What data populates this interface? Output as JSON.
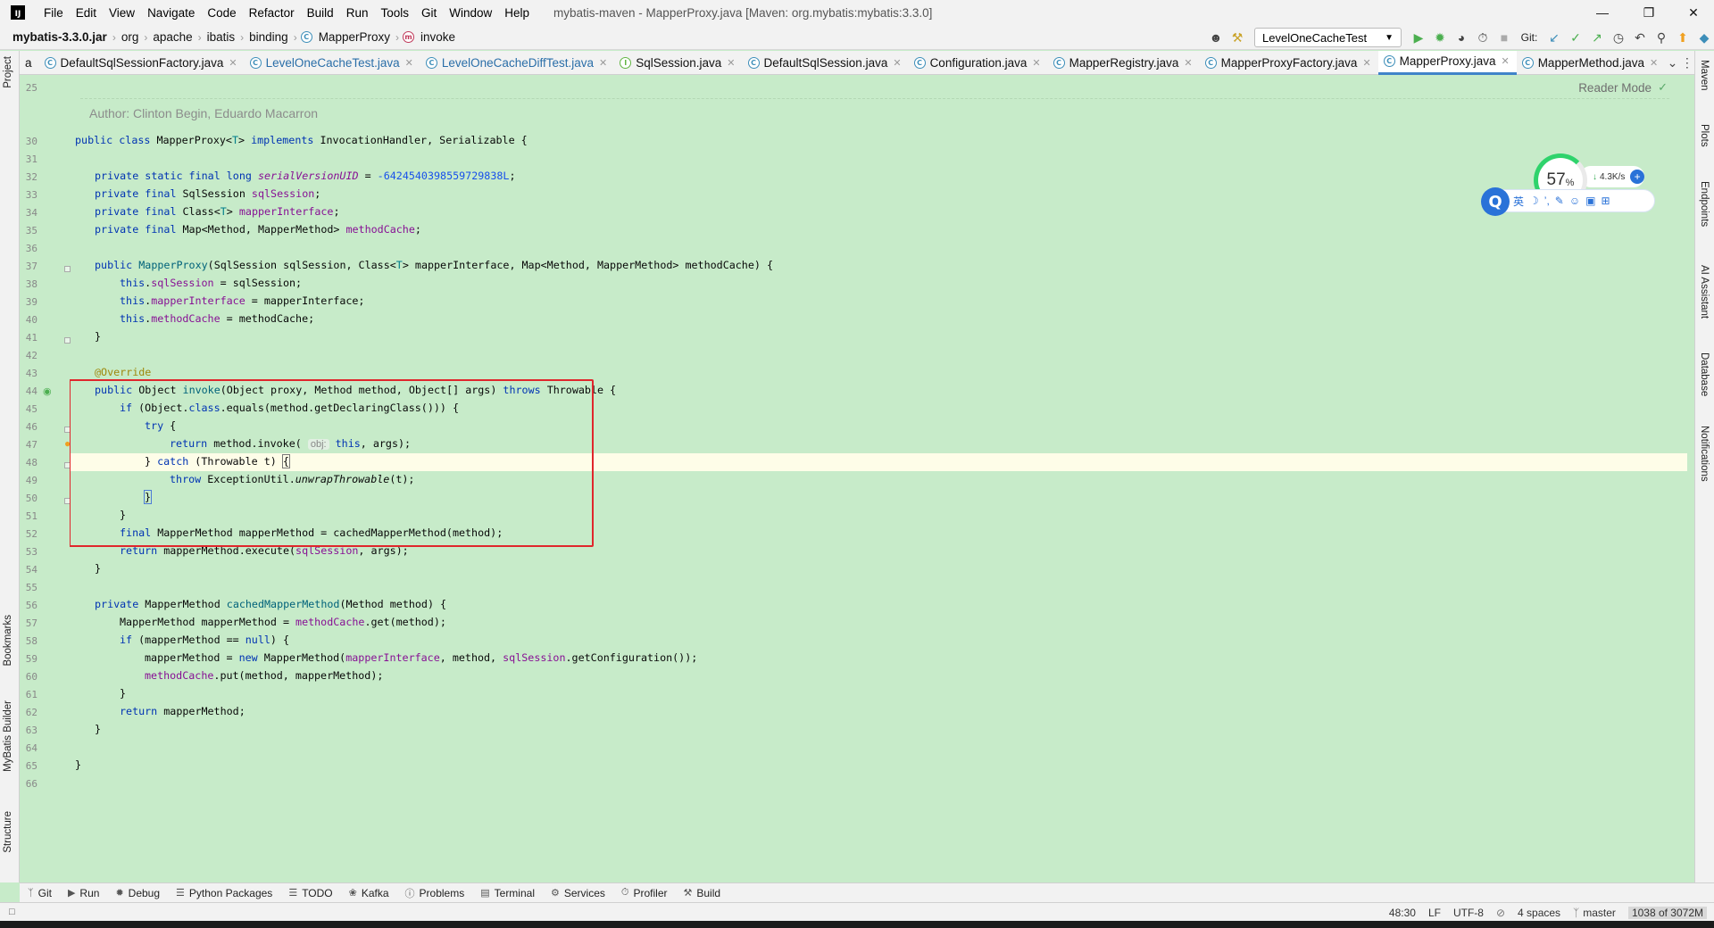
{
  "menubar": {
    "app_logo": "IJ",
    "items": [
      "File",
      "Edit",
      "View",
      "Navigate",
      "Code",
      "Refactor",
      "Build",
      "Run",
      "Tools",
      "Git",
      "Window",
      "Help"
    ],
    "window_title": "mybatis-maven - MapperProxy.java [Maven: org.mybatis:mybatis:3.3.0]",
    "window_controls": [
      "minimize-icon",
      "restore-icon",
      "close-icon"
    ]
  },
  "navbar": {
    "crumbs": [
      "mybatis-3.3.0.jar",
      "org",
      "apache",
      "ibatis",
      "binding",
      "MapperProxy",
      "invoke"
    ],
    "run_config": "LevelOneCacheTest",
    "git_label": "Git:"
  },
  "tabs": [
    {
      "label": "a",
      "kind": "partial"
    },
    {
      "label": "DefaultSqlSessionFactory.java",
      "kind": "class"
    },
    {
      "label": "LevelOneCacheTest.java",
      "kind": "test"
    },
    {
      "label": "LevelOneCacheDiffTest.java",
      "kind": "test"
    },
    {
      "label": "SqlSession.java",
      "kind": "interface"
    },
    {
      "label": "DefaultSqlSession.java",
      "kind": "class"
    },
    {
      "label": "Configuration.java",
      "kind": "class"
    },
    {
      "label": "MapperRegistry.java",
      "kind": "class"
    },
    {
      "label": "MapperProxyFactory.java",
      "kind": "class"
    },
    {
      "label": "MapperProxy.java",
      "kind": "class",
      "active": true
    },
    {
      "label": "MapperMethod.java",
      "kind": "class"
    }
  ],
  "left_tools": [
    "Project",
    "Bookmarks",
    "MyBatis Builder",
    "Structure"
  ],
  "right_tools": [
    "Maven",
    "Plots",
    "Endpoints",
    "AI Assistant",
    "Database",
    "Notifications"
  ],
  "editor": {
    "reader_mode": "Reader Mode",
    "author": "Author: Clinton Begin, Eduardo Macarron",
    "line_numbers": [
      "25",
      "30",
      "31",
      "32",
      "33",
      "34",
      "35",
      "36",
      "37",
      "38",
      "39",
      "40",
      "41",
      "42",
      "43",
      "44",
      "45",
      "46",
      "47",
      "48",
      "49",
      "50",
      "51",
      "52",
      "53",
      "54",
      "55",
      "56",
      "57",
      "58",
      "59",
      "60",
      "61",
      "62",
      "63",
      "64",
      "65",
      "66"
    ],
    "code": {
      "l30_a": "public class ",
      "l30_b": "MapperProxy<",
      "l30_c": "T",
      "l30_d": "> ",
      "l30_e": "implements",
      "l30_f": " InvocationHandler, Serializable {",
      "l32_a": "private static final long ",
      "l32_b": "serialVersionUID",
      "l32_c": " = ",
      "l32_d": "-6424540398559729838L",
      "l32_e": ";",
      "l33_a": "private final ",
      "l33_b": "SqlSession ",
      "l33_c": "sqlSession",
      "l33_d": ";",
      "l34_a": "private final ",
      "l34_b": "Class<",
      "l34_c": "T",
      "l34_d": "> ",
      "l34_e": "mapperInterface",
      "l34_f": ";",
      "l35_a": "private final ",
      "l35_b": "Map<Method, MapperMethod> ",
      "l35_c": "methodCache",
      "l35_d": ";",
      "l37_a": "public ",
      "l37_b": "MapperProxy",
      "l37_c": "(SqlSession sqlSession, Class<",
      "l37_d": "T",
      "l37_e": "> mapperInterface, Map<Method, MapperMethod> methodCache) {",
      "l38_a": "this",
      "l38_b": ".",
      "l38_c": "sqlSession",
      "l38_d": " = sqlSession;",
      "l39_a": "this",
      "l39_b": ".",
      "l39_c": "mapperInterface",
      "l39_d": " = mapperInterface;",
      "l40_a": "this",
      "l40_b": ".",
      "l40_c": "methodCache",
      "l40_d": " = methodCache;",
      "l41": "}",
      "l43": "@Override",
      "l44_a": "public ",
      "l44_b": "Object ",
      "l44_c": "invoke",
      "l44_d": "(Object proxy, Method method, Object[] args) ",
      "l44_e": "throws",
      "l44_f": " Throwable {",
      "l45_a": "if ",
      "l45_b": "(Object.",
      "l45_c": "class",
      "l45_d": ".equals(method.getDeclaringClass())) {",
      "l46_a": "try",
      "l46_b": " {",
      "l47_a": "return ",
      "l47_b": "method.invoke( ",
      "l47_hint": "obj:",
      "l47_c": " ",
      "l47_d": "this",
      "l47_e": ", args);",
      "l48_a": "} ",
      "l48_b": "catch",
      "l48_c": " (Throwable t) ",
      "l48_d": "{",
      "l49_a": "throw ",
      "l49_b": "ExceptionUtil.",
      "l49_c": "unwrapThrowable",
      "l49_d": "(t);",
      "l50": "}",
      "l51": "}",
      "l52_a": "final ",
      "l52_b": "MapperMethod mapperMethod = cachedMapperMethod(method);",
      "l53_a": "return ",
      "l53_b": "mapperMethod.execute(",
      "l53_c": "sqlSession",
      "l53_d": ", args);",
      "l54": "}",
      "l56_a": "private ",
      "l56_b": "MapperMethod ",
      "l56_c": "cachedMapperMethod",
      "l56_d": "(Method method) {",
      "l57_a": "MapperMethod mapperMethod = ",
      "l57_b": "methodCache",
      "l57_c": ".get(method);",
      "l58_a": "if ",
      "l58_b": "(mapperMethod == ",
      "l58_c": "null",
      "l58_d": ") {",
      "l59_a": "mapperMethod = ",
      "l59_b": "new ",
      "l59_c": "MapperMethod(",
      "l59_d": "mapperInterface",
      "l59_e": ", method, ",
      "l59_f": "sqlSession",
      "l59_g": ".getConfiguration());",
      "l60_a": "methodCache",
      "l60_b": ".put(method, mapperMethod);",
      "l61": "}",
      "l62_a": "return ",
      "l62_b": "mapperMethod;",
      "l63": "}",
      "l65": "}"
    }
  },
  "widget": {
    "cpu_percent": "57",
    "cpu_unit": "%",
    "net_speed": "4.3K/s",
    "ime_items": [
      "英",
      "☽",
      "’,",
      "✎",
      "☺",
      "▣",
      "⊞"
    ]
  },
  "bottom_tools": [
    "Git",
    "Run",
    "Debug",
    "Python Packages",
    "TODO",
    "Kafka",
    "Problems",
    "Terminal",
    "Services",
    "Profiler",
    "Build"
  ],
  "status": {
    "position": "48:30",
    "line_sep": "LF",
    "encoding": "UTF-8",
    "indent": "4 spaces",
    "branch": "master",
    "memory": "1038 of 3072M"
  },
  "colors": {
    "editor_bg": "#c7ebc9",
    "highlight_box": "#e0262c",
    "keyword": "#0033b3",
    "field": "#871094"
  }
}
